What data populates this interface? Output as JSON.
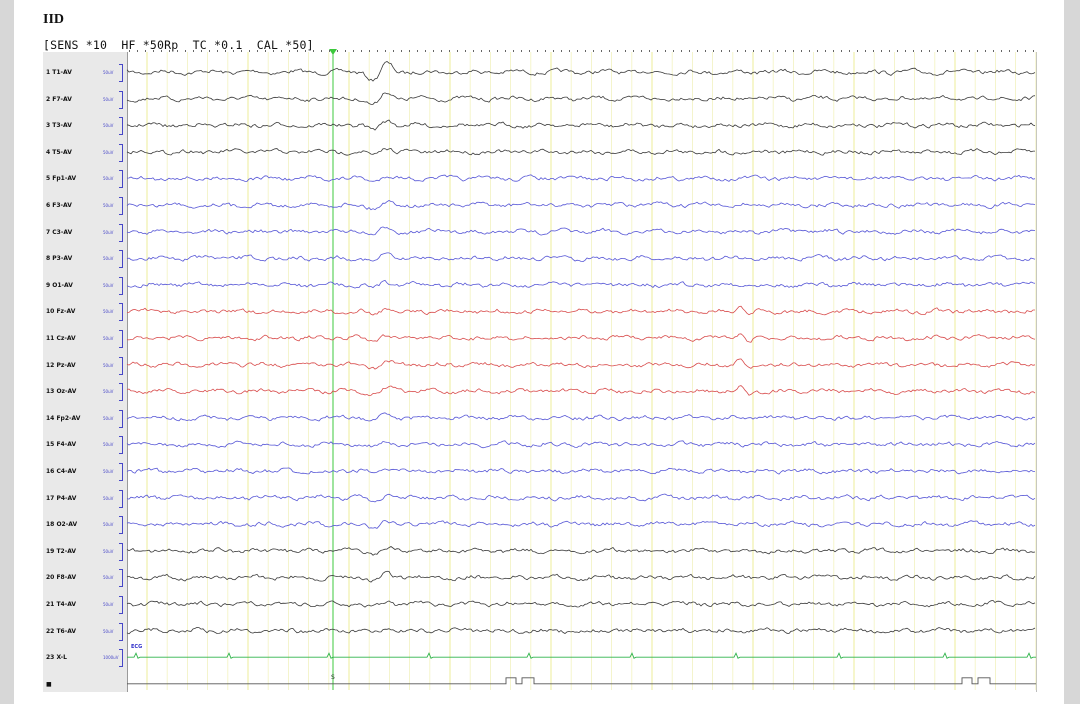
{
  "document": {
    "title": "IID",
    "params": "[SENS *10  HF *50Rp  TC *0.1  CAL *50]"
  },
  "channels": [
    {
      "num": "1",
      "label": "T1-AV",
      "cal": "50uV",
      "color": "#3a3a3a"
    },
    {
      "num": "2",
      "label": "F7-AV",
      "cal": "50uV",
      "color": "#3a3a3a"
    },
    {
      "num": "3",
      "label": "T3-AV",
      "cal": "50uV",
      "color": "#3a3a3a"
    },
    {
      "num": "4",
      "label": "T5-AV",
      "cal": "50uV",
      "color": "#3a3a3a"
    },
    {
      "num": "5",
      "label": "Fp1-AV",
      "cal": "50uV",
      "color": "#5656d6"
    },
    {
      "num": "6",
      "label": "F3-AV",
      "cal": "50uV",
      "color": "#5656d6"
    },
    {
      "num": "7",
      "label": "C3-AV",
      "cal": "50uV",
      "color": "#5656d6"
    },
    {
      "num": "8",
      "label": "P3-AV",
      "cal": "50uV",
      "color": "#5656d6"
    },
    {
      "num": "9",
      "label": "O1-AV",
      "cal": "50uV",
      "color": "#5656d6"
    },
    {
      "num": "10",
      "label": "Fz-AV",
      "cal": "50uV",
      "color": "#d84c4c"
    },
    {
      "num": "11",
      "label": "Cz-AV",
      "cal": "50uV",
      "color": "#d84c4c"
    },
    {
      "num": "12",
      "label": "Pz-AV",
      "cal": "50uV",
      "color": "#d84c4c"
    },
    {
      "num": "13",
      "label": "Oz-AV",
      "cal": "50uV",
      "color": "#d84c4c"
    },
    {
      "num": "14",
      "label": "Fp2-AV",
      "cal": "50uV",
      "color": "#5656d6"
    },
    {
      "num": "15",
      "label": "F4-AV",
      "cal": "50uV",
      "color": "#5656d6"
    },
    {
      "num": "16",
      "label": "C4-AV",
      "cal": "50uV",
      "color": "#5656d6"
    },
    {
      "num": "17",
      "label": "P4-AV",
      "cal": "50uV",
      "color": "#5656d6"
    },
    {
      "num": "18",
      "label": "O2-AV",
      "cal": "50uV",
      "color": "#5656d6"
    },
    {
      "num": "19",
      "label": "T2-AV",
      "cal": "50uV",
      "color": "#3a3a3a"
    },
    {
      "num": "20",
      "label": "F8-AV",
      "cal": "50uV",
      "color": "#3a3a3a"
    },
    {
      "num": "21",
      "label": "T4-AV",
      "cal": "50uV",
      "color": "#3a3a3a"
    },
    {
      "num": "22",
      "label": "T6-AV",
      "cal": "50uV",
      "color": "#3a3a3a"
    },
    {
      "num": "23",
      "label": "X-L",
      "cal": "1000uV",
      "color": "#2fb34a"
    },
    {
      "num": "■",
      "label": "",
      "cal": "",
      "color": "#555555"
    }
  ],
  "ecg_label": "ECG",
  "event_marker": "S",
  "colors": {
    "grid": "#f2f2c0",
    "cursor": "#3cc83c",
    "panel": "#e9e9e9"
  }
}
